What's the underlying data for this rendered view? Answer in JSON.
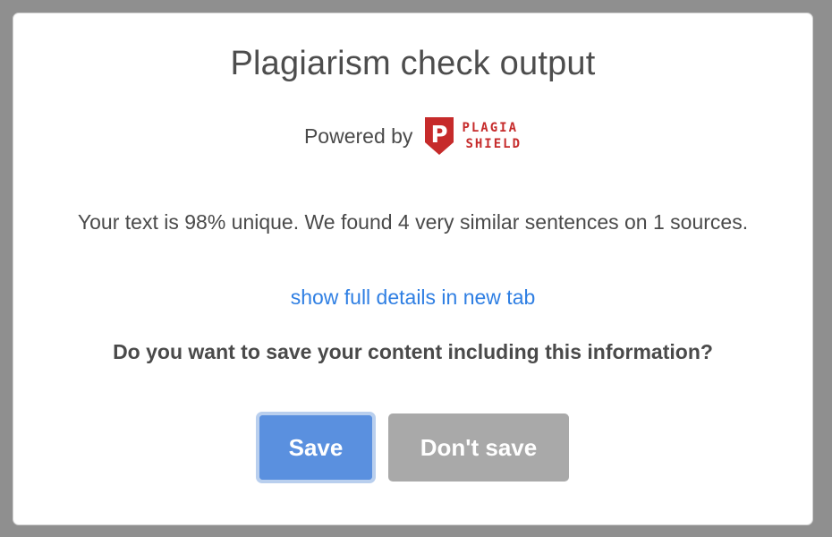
{
  "dialog": {
    "title": "Plagiarism check output",
    "powered_by": "Powered by",
    "logo": {
      "line1": "PLAGIA",
      "line2": "SHIELD",
      "letter": "P",
      "color": "#c62b2b"
    },
    "message": "Your text is 98% unique. We found 4 very similar sentences on 1 sources.",
    "details_link": "show full details in new tab",
    "question": "Do you want to save your content including this information?",
    "buttons": {
      "save": "Save",
      "dont_save": "Don't save"
    }
  },
  "colors": {
    "primary": "#5a90df",
    "secondary": "#a9a9a9",
    "link": "#2f7fe3",
    "backdrop": "#8f8f8f"
  }
}
